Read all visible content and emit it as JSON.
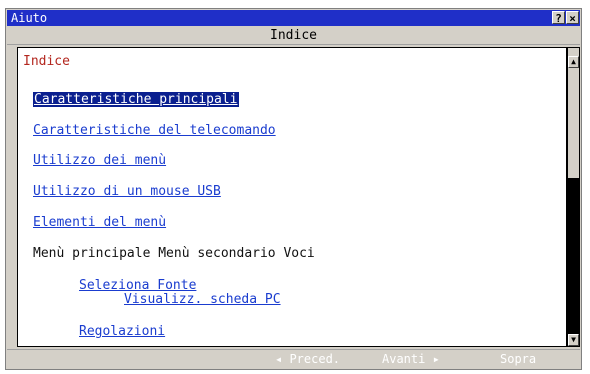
{
  "window": {
    "title": "Aiuto",
    "help_button": "?",
    "close_button": "×"
  },
  "header": {
    "title": "Indice"
  },
  "content": {
    "heading": "Indice",
    "links": [
      "Caratteristiche principali",
      "Caratteristiche del telecomando",
      "Utilizzo dei menù",
      "Utilizzo di un mouse USB",
      "Elementi del menù"
    ],
    "menu_header": "Menù principale Menù secondario Voci",
    "submenu_1": "Seleziona Fonte",
    "submenu_1_item": "Visualizz. scheda PC",
    "submenu_2": "Regolazioni"
  },
  "scrollbar": {
    "up_icon": "▲",
    "down_icon": "▼"
  },
  "footer": {
    "prev": "◂ Preced.",
    "next": "Avanti ▸",
    "top": "Sopra"
  },
  "colors": {
    "titlebar": "#1f2fc8",
    "link": "#1a3ccf",
    "selected_bg": "#0a1f8f",
    "heading": "#b3261e",
    "window_bg": "#d4d0c8"
  }
}
